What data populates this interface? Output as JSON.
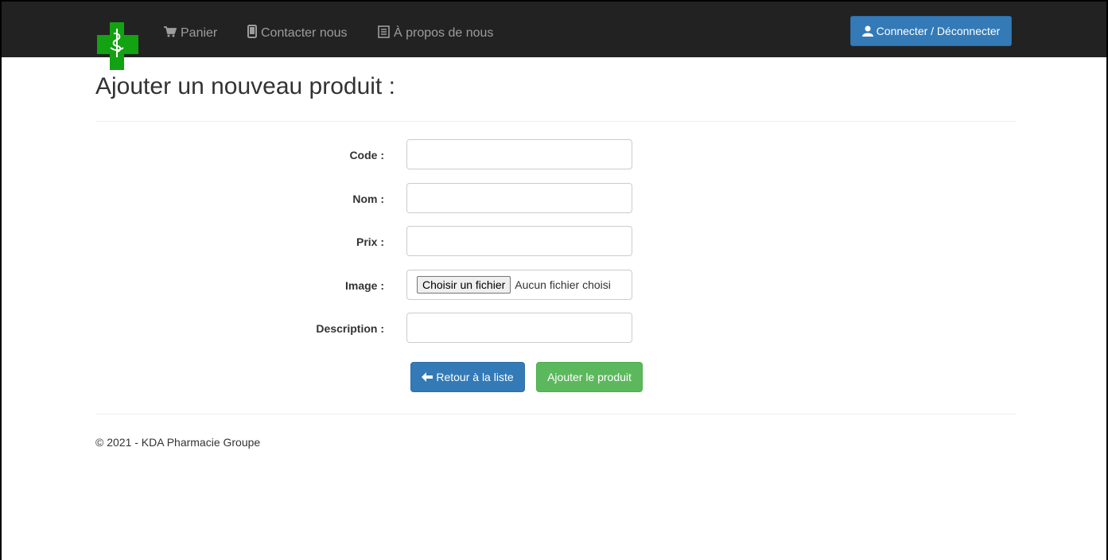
{
  "navbar": {
    "logo_icon": "pharmacy-cross-icon",
    "items": [
      {
        "label": "Panier",
        "icon": "cart-icon"
      },
      {
        "label": "Contacter nous",
        "icon": "phone-icon"
      },
      {
        "label": "À propos de nous",
        "icon": "list-icon"
      }
    ],
    "connect_label": "Connecter / Déconnecter",
    "connect_icon": "user-icon"
  },
  "page": {
    "title": "Ajouter un nouveau produit :"
  },
  "form": {
    "code_label": "Code :",
    "code_value": "",
    "nom_label": "Nom :",
    "nom_value": "",
    "prix_label": "Prix :",
    "prix_value": "",
    "image_label": "Image :",
    "file_button": "Choisir un fichier",
    "file_status": "Aucun fichier choisi",
    "description_label": "Description :",
    "description_value": ""
  },
  "actions": {
    "back_label": "Retour à la liste",
    "back_icon": "arrow-left-icon",
    "add_label": "Ajouter le produit"
  },
  "footer": {
    "text": "© 2021 - KDA Pharmacie Groupe"
  },
  "colors": {
    "navbar": "#222222",
    "primary": "#337ab7",
    "success": "#5cb85c",
    "logo_green": "#12a212"
  }
}
